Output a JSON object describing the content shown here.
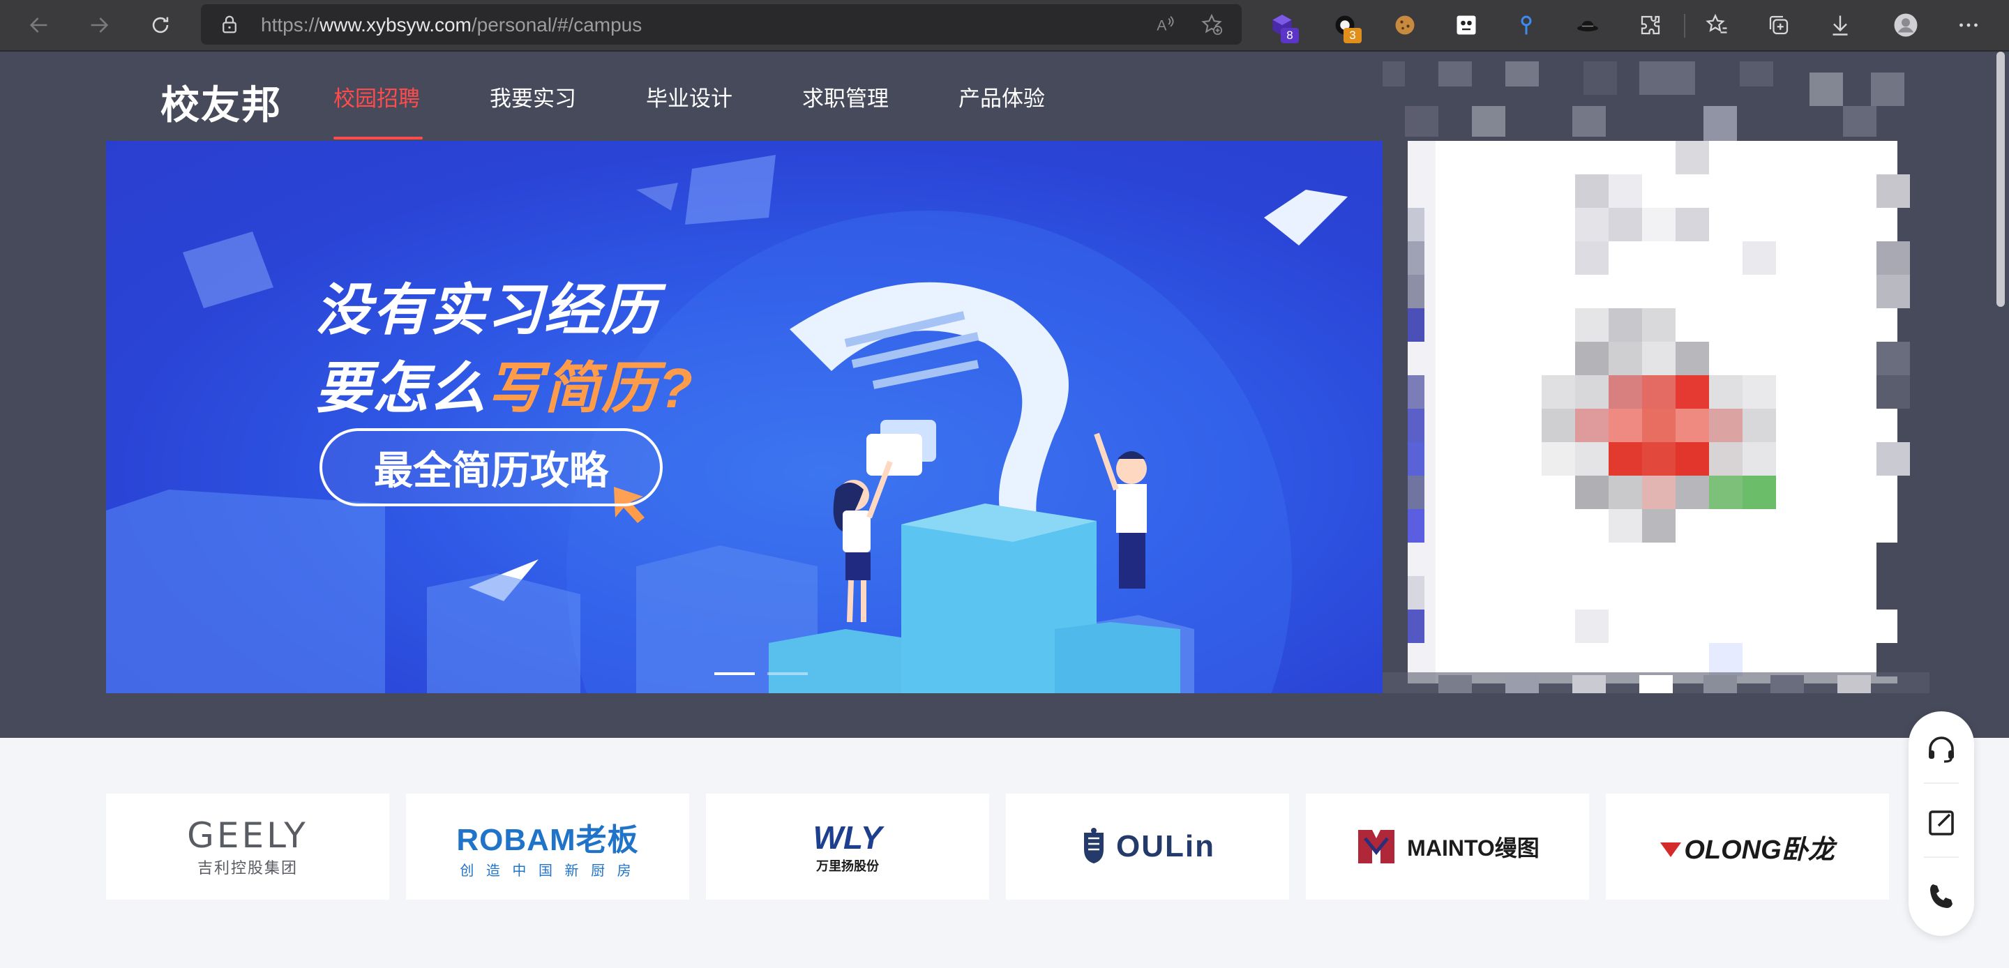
{
  "browser": {
    "url_prefix": "https://",
    "url_host": "www.xybsyw.com",
    "url_path": "/personal/#/campus",
    "extensions": [
      {
        "name": "extension-purple-cube-icon",
        "badge": "8",
        "badge_color": "#5a35c8"
      },
      {
        "name": "extension-ring-icon",
        "badge": "3",
        "badge_color": "#e08f1c"
      },
      {
        "name": "extension-cookie-icon"
      },
      {
        "name": "extension-panda-icon"
      },
      {
        "name": "extension-pin-icon"
      },
      {
        "name": "extension-hat-icon"
      }
    ]
  },
  "site": {
    "logo": "校友邦",
    "nav": [
      {
        "label": "校园招聘",
        "active": true
      },
      {
        "label": "我要实习"
      },
      {
        "label": "毕业设计"
      },
      {
        "label": "求职管理"
      },
      {
        "label": "产品体验"
      }
    ],
    "accent_color": "#ff4b4b"
  },
  "banner": {
    "line1": "没有实习经历",
    "line2_prefix": "要怎么",
    "line2_highlight": "写简历?",
    "button": "最全简历攻略",
    "slides": 2,
    "active_slide": 1
  },
  "partners": [
    {
      "name": "GEELY",
      "sub": "吉利控股集团"
    },
    {
      "name": "ROBAM老板",
      "sub": "创 造 中 国 新 厨 房"
    },
    {
      "name": "WLY",
      "sub": "万里扬股份"
    },
    {
      "name": "OULin",
      "sub": ""
    },
    {
      "name": "MAINTO缦图",
      "sub": ""
    },
    {
      "name": "OLONG卧龙",
      "sub": ""
    }
  ],
  "float_bar": [
    "headset-icon",
    "edit-icon",
    "phone-icon"
  ]
}
